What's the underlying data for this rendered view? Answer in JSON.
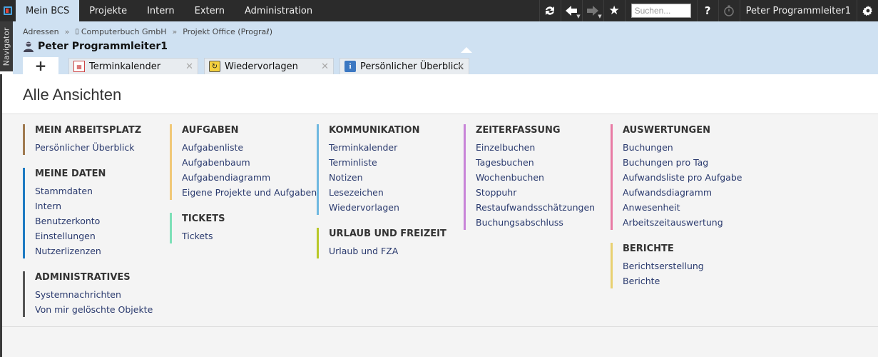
{
  "topbar": {
    "tabs": [
      "Mein BCS",
      "Projekte",
      "Intern",
      "Extern",
      "Administration"
    ],
    "search_placeholder": "Suchen...",
    "help": "?",
    "user": "Peter Programmleiter1",
    "icons": [
      "refresh-icon",
      "back-icon",
      "forward-icon",
      "star-icon",
      "help-icon",
      "stopwatch-icon",
      "gear-icon"
    ]
  },
  "navigator": {
    "label": "Navigator"
  },
  "breadcrumb": [
    "Adressen",
    "Computerbuch GmbH",
    "Projekt Office (Prograℓ)"
  ],
  "person": {
    "name": "Peter Programmleiter1"
  },
  "tabs": [
    {
      "label": "Terminkalender",
      "icon": "calendar-icon"
    },
    {
      "label": "Wiedervorlagen",
      "icon": "resubmission-icon"
    },
    {
      "label": "Persönlicher Überblick",
      "icon": "info-icon"
    }
  ],
  "page": {
    "title": "Alle Ansichten"
  },
  "columns": [
    [
      {
        "title": "MEIN ARBEITSPLATZ",
        "color": "#a07a50",
        "links": [
          "Persönlicher Überblick"
        ]
      },
      {
        "title": "MEINE DATEN",
        "color": "#1e7ac2",
        "links": [
          "Stammdaten",
          "Intern",
          "Benutzerkonto",
          "Einstellungen",
          "Nutzerlizenzen"
        ]
      },
      {
        "title": "ADMINISTRATIVES",
        "color": "#555555",
        "links": [
          "Systemnachrichten",
          "Von mir gelöschte Objekte"
        ]
      }
    ],
    [
      {
        "title": "AUFGABEN",
        "color": "#f0c878",
        "links": [
          "Aufgabenliste",
          "Aufgabenbaum",
          "Aufgabendiagramm",
          "Eigene Projekte und Aufgaben"
        ]
      },
      {
        "title": "TICKETS",
        "color": "#7ee0b8",
        "links": [
          "Tickets"
        ]
      }
    ],
    [
      {
        "title": "KOMMUNIKATION",
        "color": "#6fb8e0",
        "links": [
          "Terminkalender",
          "Terminliste",
          "Notizen",
          "Lesezeichen",
          "Wiedervorlagen"
        ]
      },
      {
        "title": "URLAUB UND FREIZEIT",
        "color": "#b8c828",
        "links": [
          "Urlaub und FZA"
        ]
      }
    ],
    [
      {
        "title": "ZEITERFASSUNG",
        "color": "#c884d8",
        "links": [
          "Einzelbuchen",
          "Tagesbuchen",
          "Wochenbuchen",
          "Stoppuhr",
          "Restaufwandsschätzungen",
          "Buchungsabschluss"
        ]
      }
    ],
    [
      {
        "title": "AUSWERTUNGEN",
        "color": "#e87aa4",
        "links": [
          "Buchungen",
          "Buchungen pro Tag",
          "Aufwandsliste pro Aufgabe",
          "Aufwandsdiagramm",
          "Anwesenheit",
          "Arbeitszeitauswertung"
        ]
      },
      {
        "title": "BERICHTE",
        "color": "#e8d070",
        "links": [
          "Berichtserstellung",
          "Berichte"
        ]
      }
    ]
  ]
}
